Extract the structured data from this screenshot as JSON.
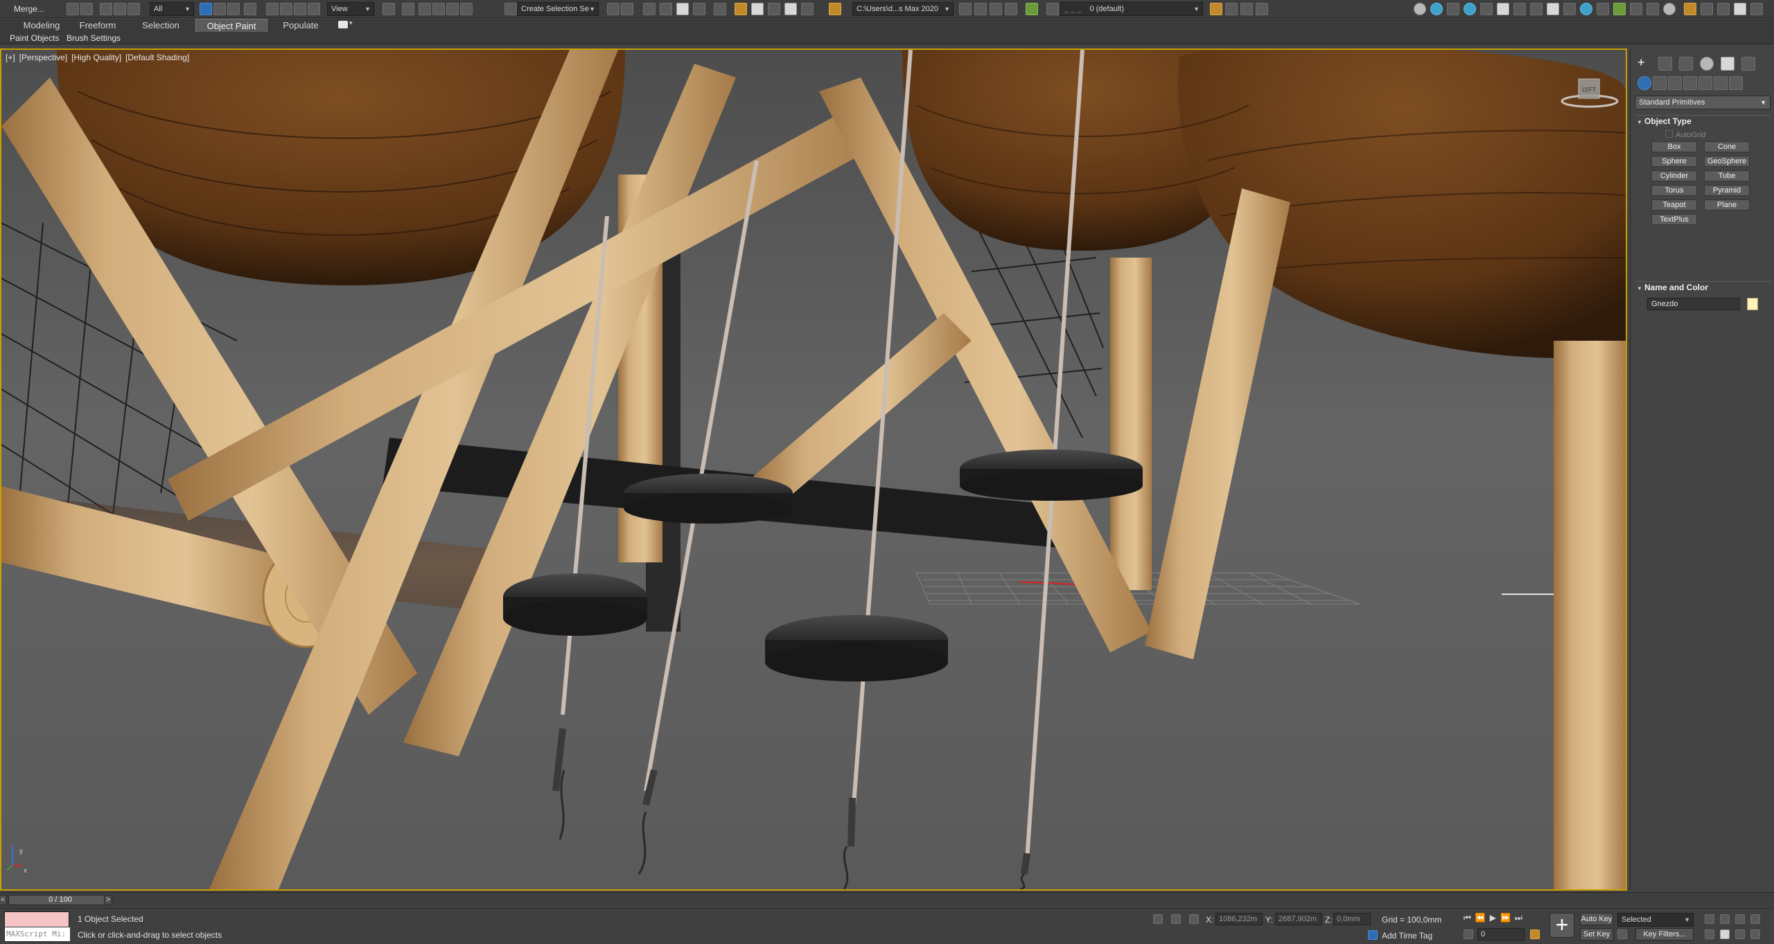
{
  "toolbar": {
    "merge_label": "Merge...",
    "filter_value": "All",
    "ref_coord_value": "View",
    "named_selection_value": "Create Selection Se",
    "project_path": "C:\\Users\\d...s Max 2020",
    "layer_value": "0 (default)"
  },
  "ribbon": {
    "tabs": [
      "Modeling",
      "Freeform",
      "Selection",
      "Object Paint",
      "Populate"
    ],
    "active_tab": "Object Paint",
    "subtabs": [
      "Paint Objects",
      "Brush Settings"
    ]
  },
  "viewport": {
    "labels": [
      "[+]",
      "[Perspective]",
      "[High Quality]",
      "[Default Shading]"
    ],
    "viewcube_label": "LEFT",
    "axis_labels": [
      "x",
      "y"
    ]
  },
  "command_panel": {
    "category_dropdown": "Standard Primitives",
    "rollout_object_type": "Object Type",
    "autogrid_label": "AutoGrid",
    "buttons": [
      "Box",
      "Cone",
      "Sphere",
      "GeoSphere",
      "Cylinder",
      "Tube",
      "Torus",
      "Pyramid",
      "Teapot",
      "Plane",
      "TextPlus"
    ],
    "rollout_name_color": "Name and Color",
    "object_name": "Gnezdo",
    "object_color": "#fff2b8"
  },
  "timeline": {
    "frame_display": "0 / 100",
    "prev_symbol": "<",
    "next_symbol": ">"
  },
  "status": {
    "maxscript_placeholder": "MAXScript Mi:",
    "selection_info": "1 Object Selected",
    "prompt": "Click or click-and-drag to select objects",
    "x_label": "X:",
    "x_value": "1086,232m",
    "y_label": "Y:",
    "y_value": "2687,902m",
    "z_label": "Z:",
    "z_value": "0,0mm",
    "grid": "Grid = 100,0mm",
    "add_time_tag": "Add Time Tag",
    "auto_key": "Auto Key",
    "set_key": "Set Key",
    "key_mode_value": "Selected",
    "key_filters": "Key Filters...",
    "frame_value": "0"
  }
}
